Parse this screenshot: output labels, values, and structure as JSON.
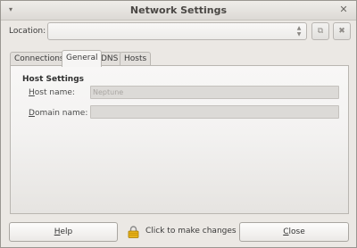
{
  "window": {
    "title": "Network Settings",
    "menu_glyph": "▾",
    "close_glyph": "✕"
  },
  "location": {
    "label": "Location:",
    "value": "",
    "arrows_up": "▲",
    "arrows_down": "▼"
  },
  "toolbar": {
    "save_glyph": "⧉",
    "delete_glyph": "✖"
  },
  "tabs": [
    {
      "label": "Connections",
      "active": false
    },
    {
      "label": "General",
      "active": true
    },
    {
      "label": "DNS",
      "active": false
    },
    {
      "label": "Hosts",
      "active": false
    }
  ],
  "host_settings": {
    "title": "Host Settings",
    "host_name_label_prefix": "",
    "host_name_label_mnemonic": "H",
    "host_name_label_rest": "ost name:",
    "host_name_value": "Neptune",
    "domain_name_label_prefix": "",
    "domain_name_label_mnemonic": "D",
    "domain_name_label_rest": "omain name:",
    "domain_name_value": ""
  },
  "footer": {
    "help_mnemonic": "H",
    "help_rest": "elp",
    "lock_text": "Click to make changes",
    "close_mnemonic": "C",
    "close_rest": "lose"
  },
  "colors": {
    "window_bg": "#ebe8e4",
    "lock_icon": "#d9a400"
  },
  "icons": {
    "lock": "lock-icon",
    "save": "save-icon",
    "delete": "delete-icon",
    "menu": "chevron-down-icon",
    "close": "close-icon"
  }
}
